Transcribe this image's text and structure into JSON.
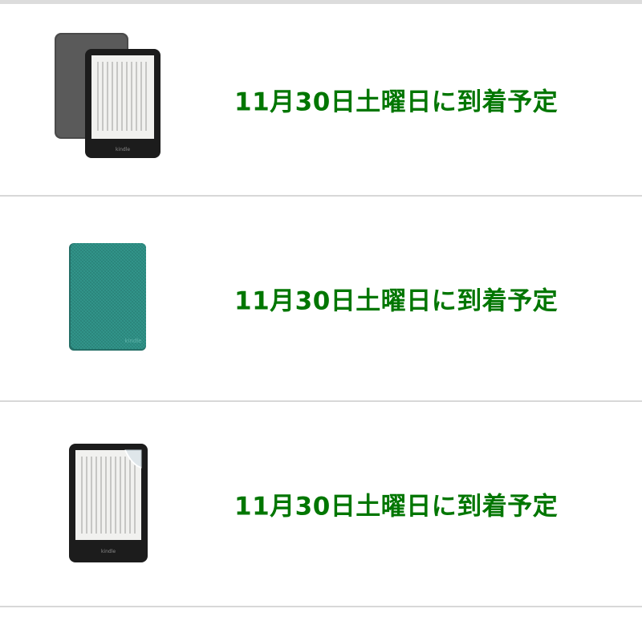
{
  "items": [
    {
      "delivery_text": "11月30日土曜日に到着予定",
      "thumbnail_icon": "kindle-device-icon",
      "thumbnail_brand": "kindle"
    },
    {
      "delivery_text": "11月30日土曜日に到着予定",
      "thumbnail_icon": "kindle-cover-icon",
      "thumbnail_brand": "kindle"
    },
    {
      "delivery_text": "11月30日土曜日に到着予定",
      "thumbnail_icon": "screen-protector-icon",
      "thumbnail_brand": "kindle"
    }
  ],
  "colors": {
    "delivery_green": "#007600",
    "divider": "#d8d8d8",
    "cover_teal": "#2f8f85",
    "device_black": "#1c1c1c"
  }
}
